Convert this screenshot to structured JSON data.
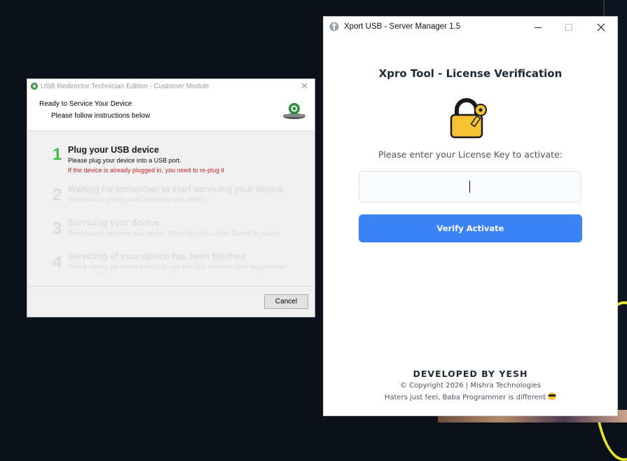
{
  "left_window": {
    "title": "USB Redirector Technician Edition - Customer Module",
    "header_title": "Ready to Service Your Device",
    "header_subtitle": "Please follow instructions below",
    "steps": [
      {
        "num": "1",
        "title": "Plug your USB device",
        "desc": "Please plug your device into a USB port.",
        "warning": "If the device is already plugged in, you need to re-plug it"
      },
      {
        "num": "2",
        "title": "Waiting for technician to start servicing your device",
        "desc": "Technician is getting ready to service your device"
      },
      {
        "num": "3",
        "title": "Servicing your device",
        "desc": "Technician is servicing your device. This may take a while. Please be patient"
      },
      {
        "num": "4",
        "title": "Servicing of your device has been finished",
        "desc": "Please unplug the device from USB port and click Finish to close this program"
      }
    ],
    "cancel_label": "Cancel"
  },
  "right_window": {
    "title": "Xport USB - Server Manager 1.5",
    "main_title": "Xpro Tool - License Verification",
    "prompt": "Please enter your License Key to activate:",
    "license_value": "",
    "license_placeholder": "",
    "verify_label": "Verify  Activate",
    "developed_by": "DEVELOPED BY YESH",
    "copyright": "© Copyright 2026 | Mishra Technologies",
    "tagline": "Haters just feel, Baba Programmer is different",
    "emoji_icon": "sunglasses-emoji-icon",
    "accent_color": "#3b82f6"
  }
}
